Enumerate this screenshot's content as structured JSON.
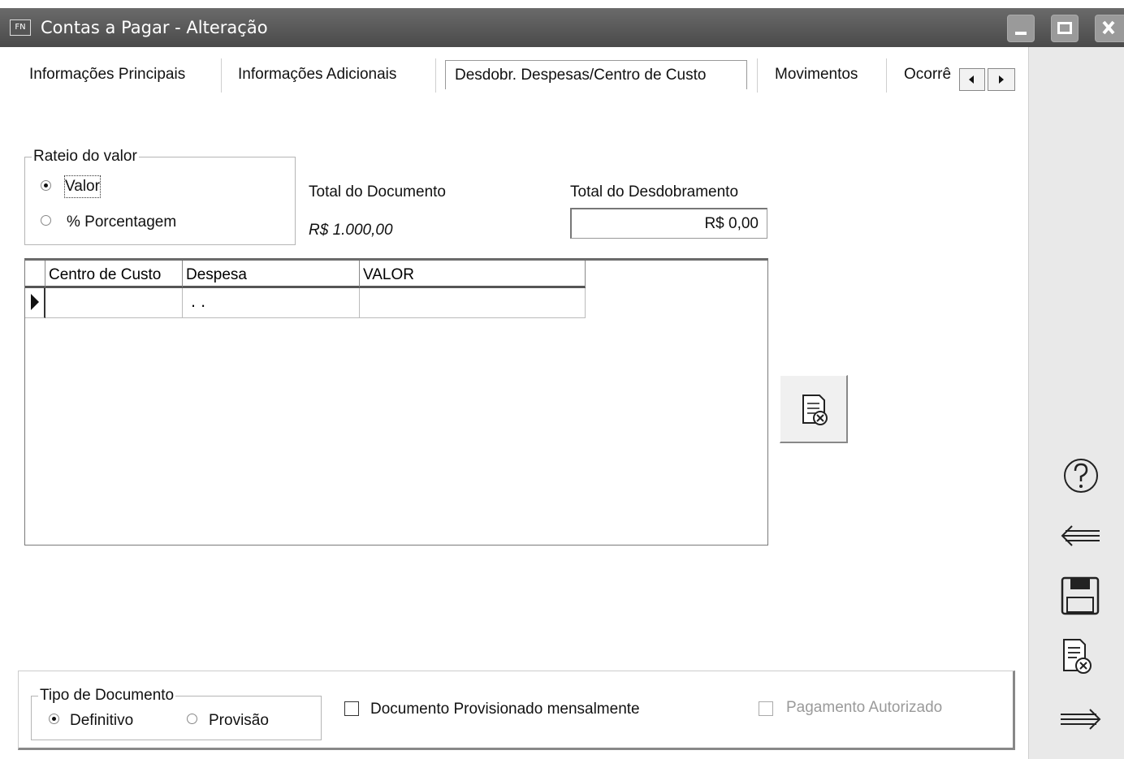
{
  "window": {
    "app_badge": "FN",
    "title": "Contas a Pagar - Alteração"
  },
  "tabs": [
    {
      "label": "Informações Principais"
    },
    {
      "label": "Informações Adicionais"
    },
    {
      "label": "Desdobr. Despesas/Centro de Custo",
      "active": true
    },
    {
      "label": "Movimentos"
    },
    {
      "label": "Ocorrê"
    }
  ],
  "rateio": {
    "legend": "Rateio do valor",
    "options": [
      {
        "label": "Valor",
        "selected": true
      },
      {
        "label": "% Porcentagem",
        "selected": false
      }
    ]
  },
  "totals": {
    "documento_label": "Total do Documento",
    "documento_value": "R$ 1.000,00",
    "desdobramento_label": "Total do Desdobramento",
    "desdobramento_value": "R$ 0,00"
  },
  "grid": {
    "columns": [
      "Centro de Custo",
      "Despesa",
      "VALOR"
    ],
    "rows": [
      {
        "centro": "",
        "despesa": ". .",
        "valor": ""
      }
    ]
  },
  "tipo_documento": {
    "legend": "Tipo de Documento",
    "options": [
      {
        "label": "Definitivo",
        "selected": true
      },
      {
        "label": "Provisão",
        "selected": false
      }
    ]
  },
  "checkboxes": {
    "provisionado": {
      "label": "Documento Provisionado mensalmente",
      "checked": false
    },
    "pagamento": {
      "label": "Pagamento Autorizado",
      "checked": false,
      "disabled": true
    }
  },
  "sidebar": {
    "icons": [
      "help-icon",
      "back-arrow-icon",
      "save-icon",
      "delete-document-icon",
      "forward-arrow-icon"
    ]
  }
}
